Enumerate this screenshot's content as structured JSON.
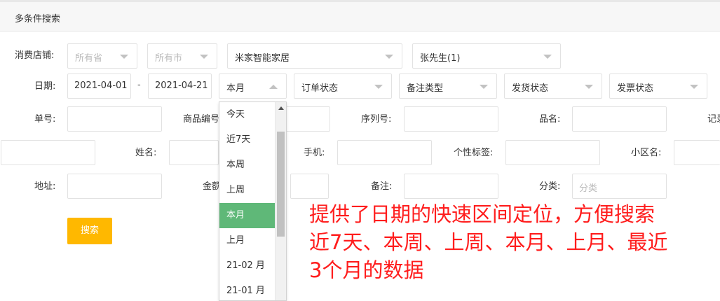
{
  "header": {
    "title": "多条件搜索"
  },
  "row1": {
    "store_label": "消费店铺:",
    "province": {
      "value": "所有省"
    },
    "city": {
      "value": "所有市"
    },
    "store": {
      "value": "米家智能家居"
    },
    "person": {
      "value": "张先生(1)"
    }
  },
  "row2": {
    "date_label": "日期:",
    "start_date": "2021-04-01",
    "separator": "-",
    "end_date": "2021-04-21",
    "range": {
      "value": "本月"
    },
    "order_status": {
      "value": "订单状态"
    },
    "remark_type": {
      "value": "备注类型"
    },
    "ship_status": {
      "value": "发货状态"
    },
    "invoice_status": {
      "value": "发票状态"
    }
  },
  "row3": {
    "order_no_label": "单号:",
    "product_code_label": "商品编号",
    "serial_label": "序列号:",
    "product_name_label": "品名:",
    "record_label": "记录"
  },
  "row4": {
    "name_label": "姓名:",
    "phone_label": "手机:",
    "tag_label": "个性标签:",
    "district_label": "小区名:"
  },
  "row5": {
    "address_label": "地址:",
    "amount_label": "金额",
    "remark_label": "备注:",
    "category_label": "分类:",
    "category_placeholder": "分类"
  },
  "search_button": "搜索",
  "dropdown": {
    "items": [
      "今天",
      "近7天",
      "本周",
      "上周",
      "本月",
      "上月",
      "21-02 月",
      "21-01 月"
    ],
    "selected": "本月"
  },
  "annotation": {
    "line1": "提供了日期的快速区间定位，方便搜索",
    "line2": "近7天、本周、上周、本月、上月、最近",
    "line3": "3个月的数据"
  },
  "colors": {
    "accent_button": "#ffb800",
    "selected_item": "#5fb878",
    "annotation_text": "#ff1d1d"
  }
}
